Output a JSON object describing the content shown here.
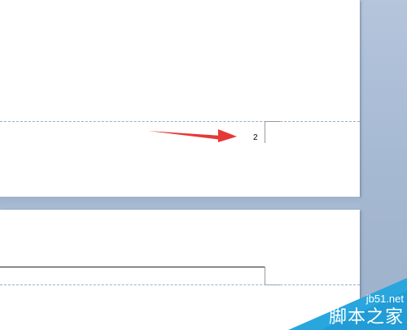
{
  "document": {
    "page_number": "2"
  },
  "annotation": {
    "arrow_color": "#e53935"
  },
  "watermark": {
    "url": "jb51.net",
    "name": "脚本之家",
    "color": "#29a6de"
  },
  "colors": {
    "workspace": "#a9bcd6",
    "page": "#ffffff",
    "boundary_line": "#8fb0d2"
  }
}
